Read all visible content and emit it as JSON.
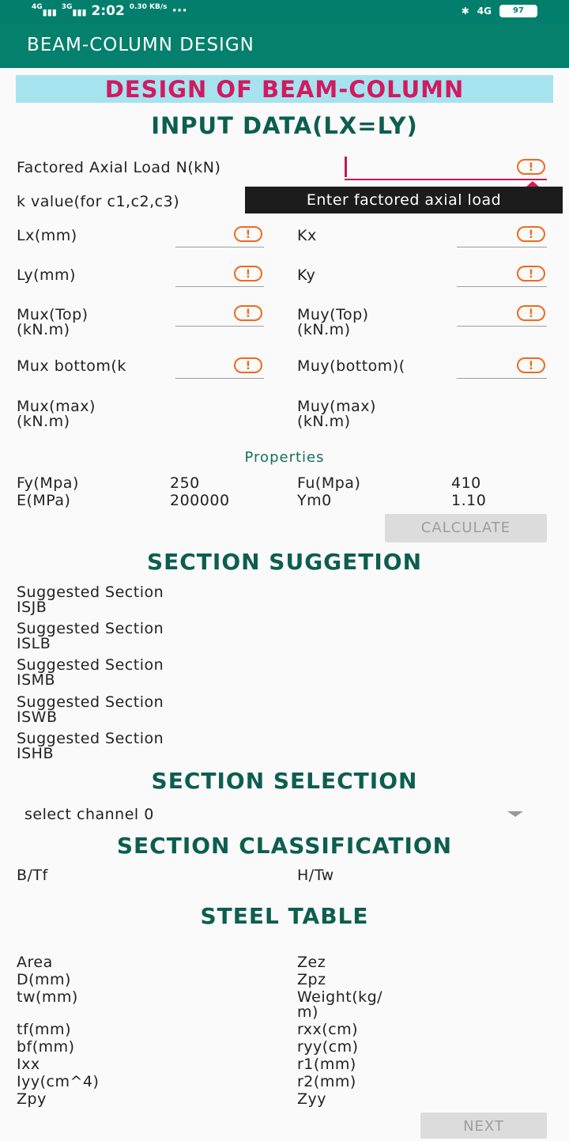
{
  "statusbar": {
    "signal_left": "4G",
    "signal_right": "3G",
    "time": "2:02",
    "speed": "0.30 KB/s",
    "dots": "···",
    "bluetooth": "✱",
    "network": "4G",
    "battery": "97"
  },
  "appbar": {
    "title": "BEAM-COLUMN DESIGN"
  },
  "banner": "DESIGN OF BEAM-COLUMN",
  "input_heading": "INPUT DATA(LX=LY)",
  "inputs": {
    "axial_load_label": "Factored Axial Load N(kN)",
    "k_value_label": "k value(for c1,c2,c3)",
    "tooltip": "Enter factored axial load",
    "lx_label": "Lx(mm)",
    "kx_label": "Kx",
    "ly_label": "Ly(mm)",
    "ky_label": "Ky",
    "mux_top_label_1": "Mux(Top)",
    "mux_top_label_2": "(kN.m)",
    "muy_top_label_1": "Muy(Top)",
    "muy_top_label_2": "(kN.m)",
    "mux_bottom_label": "Mux bottom(k",
    "muy_bottom_label": "Muy(bottom)(",
    "mux_max_label_1": "Mux(max)",
    "mux_max_label_2": "(kN.m)",
    "muy_max_label_1": "Muy(max)",
    "muy_max_label_2": "(kN.m)",
    "warn_glyph": "!"
  },
  "properties": {
    "title": "Properties",
    "fy_label": "Fy(Mpa)",
    "fy_value": "250",
    "fu_label": "Fu(Mpa)",
    "fu_value": "410",
    "e_label": "E(MPa)",
    "e_value": "200000",
    "ym0_label": "Ym0",
    "ym0_value": "1.10"
  },
  "calculate_button": "CALCULATE",
  "section_suggestion": {
    "heading": "SECTION SUGGETION",
    "items": [
      {
        "line1": "Suggested Section",
        "line2": "ISJB"
      },
      {
        "line1": "Suggested Section",
        "line2": "ISLB"
      },
      {
        "line1": "Suggested Section",
        "line2": "ISMB"
      },
      {
        "line1": "Suggested Section",
        "line2": "ISWB"
      },
      {
        "line1": "Suggested Section",
        "line2": "ISHB"
      }
    ]
  },
  "section_selection": {
    "heading": "SECTION SELECTION",
    "selected": "select channel 0"
  },
  "section_classification": {
    "heading": "SECTION CLASSIFICATION",
    "bt_label": "B/Tf",
    "ht_label": "H/Tw"
  },
  "steel_table": {
    "heading": "STEEL TABLE",
    "left": [
      "Area",
      "D(mm)",
      "tw(mm)",
      "tf(mm)",
      "bf(mm)",
      "Ixx",
      "Iyy(cm^4)",
      "Zpy"
    ],
    "right": [
      "Zez",
      "Zpz",
      "Weight(kg/",
      "m)",
      "rxx(cm)",
      "ryy(cm)",
      "r1(mm)",
      "r2(mm)",
      "Zyy"
    ]
  },
  "next_button": "NEXT"
}
